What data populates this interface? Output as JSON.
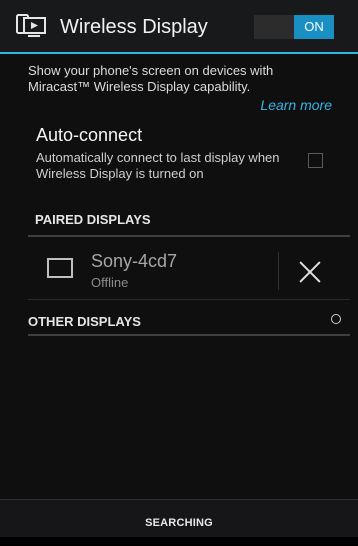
{
  "action_bar": {
    "title": "Wireless Display",
    "toggle_label": "ON",
    "app_icon": "wireless-display-icon",
    "accent_color": "#33b5e5"
  },
  "description": {
    "text": "Show your phone's screen on devices with Miracast™ Wireless Display capability.",
    "learn_more": "Learn more"
  },
  "auto_connect": {
    "title": "Auto-connect",
    "summary": "Automatically connect to last display when Wireless Display is turned on",
    "checked": false
  },
  "paired_displays": {
    "header": "PAIRED DISPLAYS",
    "devices": [
      {
        "name": "Sony-4cd7",
        "status": "Offline",
        "icon": "display-icon",
        "action_icon": "close-icon"
      }
    ]
  },
  "other_displays": {
    "header": "OTHER DISPLAYS",
    "indicator_icon": "progress-spinner-icon"
  },
  "bottom_bar": {
    "label": "SEARCHING"
  }
}
